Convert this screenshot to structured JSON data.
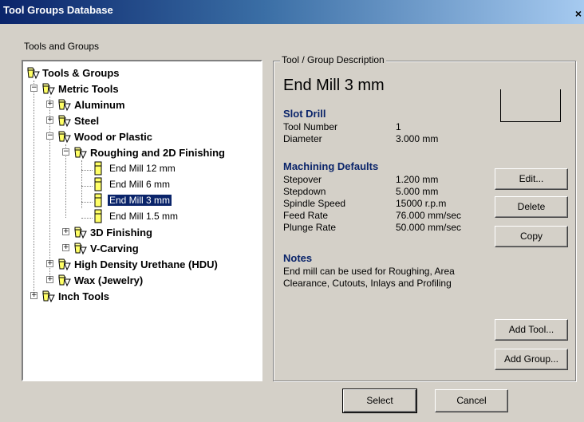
{
  "window": {
    "title": "Tool Groups Database",
    "close_glyph": "×"
  },
  "tree_section": {
    "label": "Tools and Groups"
  },
  "tree": [
    {
      "label": "Tools & Groups"
    },
    {
      "label": "Metric Tools"
    },
    {
      "label": "Aluminum"
    },
    {
      "label": "Steel"
    },
    {
      "label": "Wood or Plastic"
    },
    {
      "label": "Roughing and 2D Finishing"
    },
    {
      "label": "End Mill 12 mm"
    },
    {
      "label": "End Mill 6 mm"
    },
    {
      "label": "End Mill 3 mm"
    },
    {
      "label": "End Mill 1.5 mm"
    },
    {
      "label": "3D Finishing"
    },
    {
      "label": "V-Carving"
    },
    {
      "label": "High Density Urethane (HDU)"
    },
    {
      "label": "Wax (Jewelry)"
    },
    {
      "label": "Inch Tools"
    }
  ],
  "description": {
    "group_label": "Tool / Group Description",
    "name": "End Mill 3 mm",
    "type_heading": "Slot Drill",
    "tool_number_label": "Tool Number",
    "tool_number_value": "1",
    "diameter_label": "Diameter",
    "diameter_value": "3.000 mm",
    "defaults_heading": "Machining Defaults",
    "stepover_label": "Stepover",
    "stepover_value": "1.200 mm",
    "stepdown_label": "Stepdown",
    "stepdown_value": "5.000 mm",
    "spindle_label": "Spindle Speed",
    "spindle_value": "15000 r.p.m",
    "feed_label": "Feed Rate",
    "feed_value": "76.000 mm/sec",
    "plunge_label": "Plunge Rate",
    "plunge_value": "50.000 mm/sec",
    "notes_heading": "Notes",
    "notes_line1": "End mill can be used for Roughing, Area",
    "notes_line2": "Clearance, Cutouts, Inlays and Profiling"
  },
  "buttons": {
    "edit": "Edit...",
    "delete": "Delete",
    "copy": "Copy",
    "add_tool": "Add Tool...",
    "add_group": "Add Group...",
    "select": "Select",
    "cancel": "Cancel"
  },
  "colors": {
    "title_start": "#0a246a",
    "title_end": "#a6caf0",
    "face": "#d4d0c8",
    "selection": "#0a246a",
    "heading": "#0a246a"
  },
  "icons": {
    "folder": "folder-group-icon",
    "tool": "end-mill-tool-icon"
  }
}
